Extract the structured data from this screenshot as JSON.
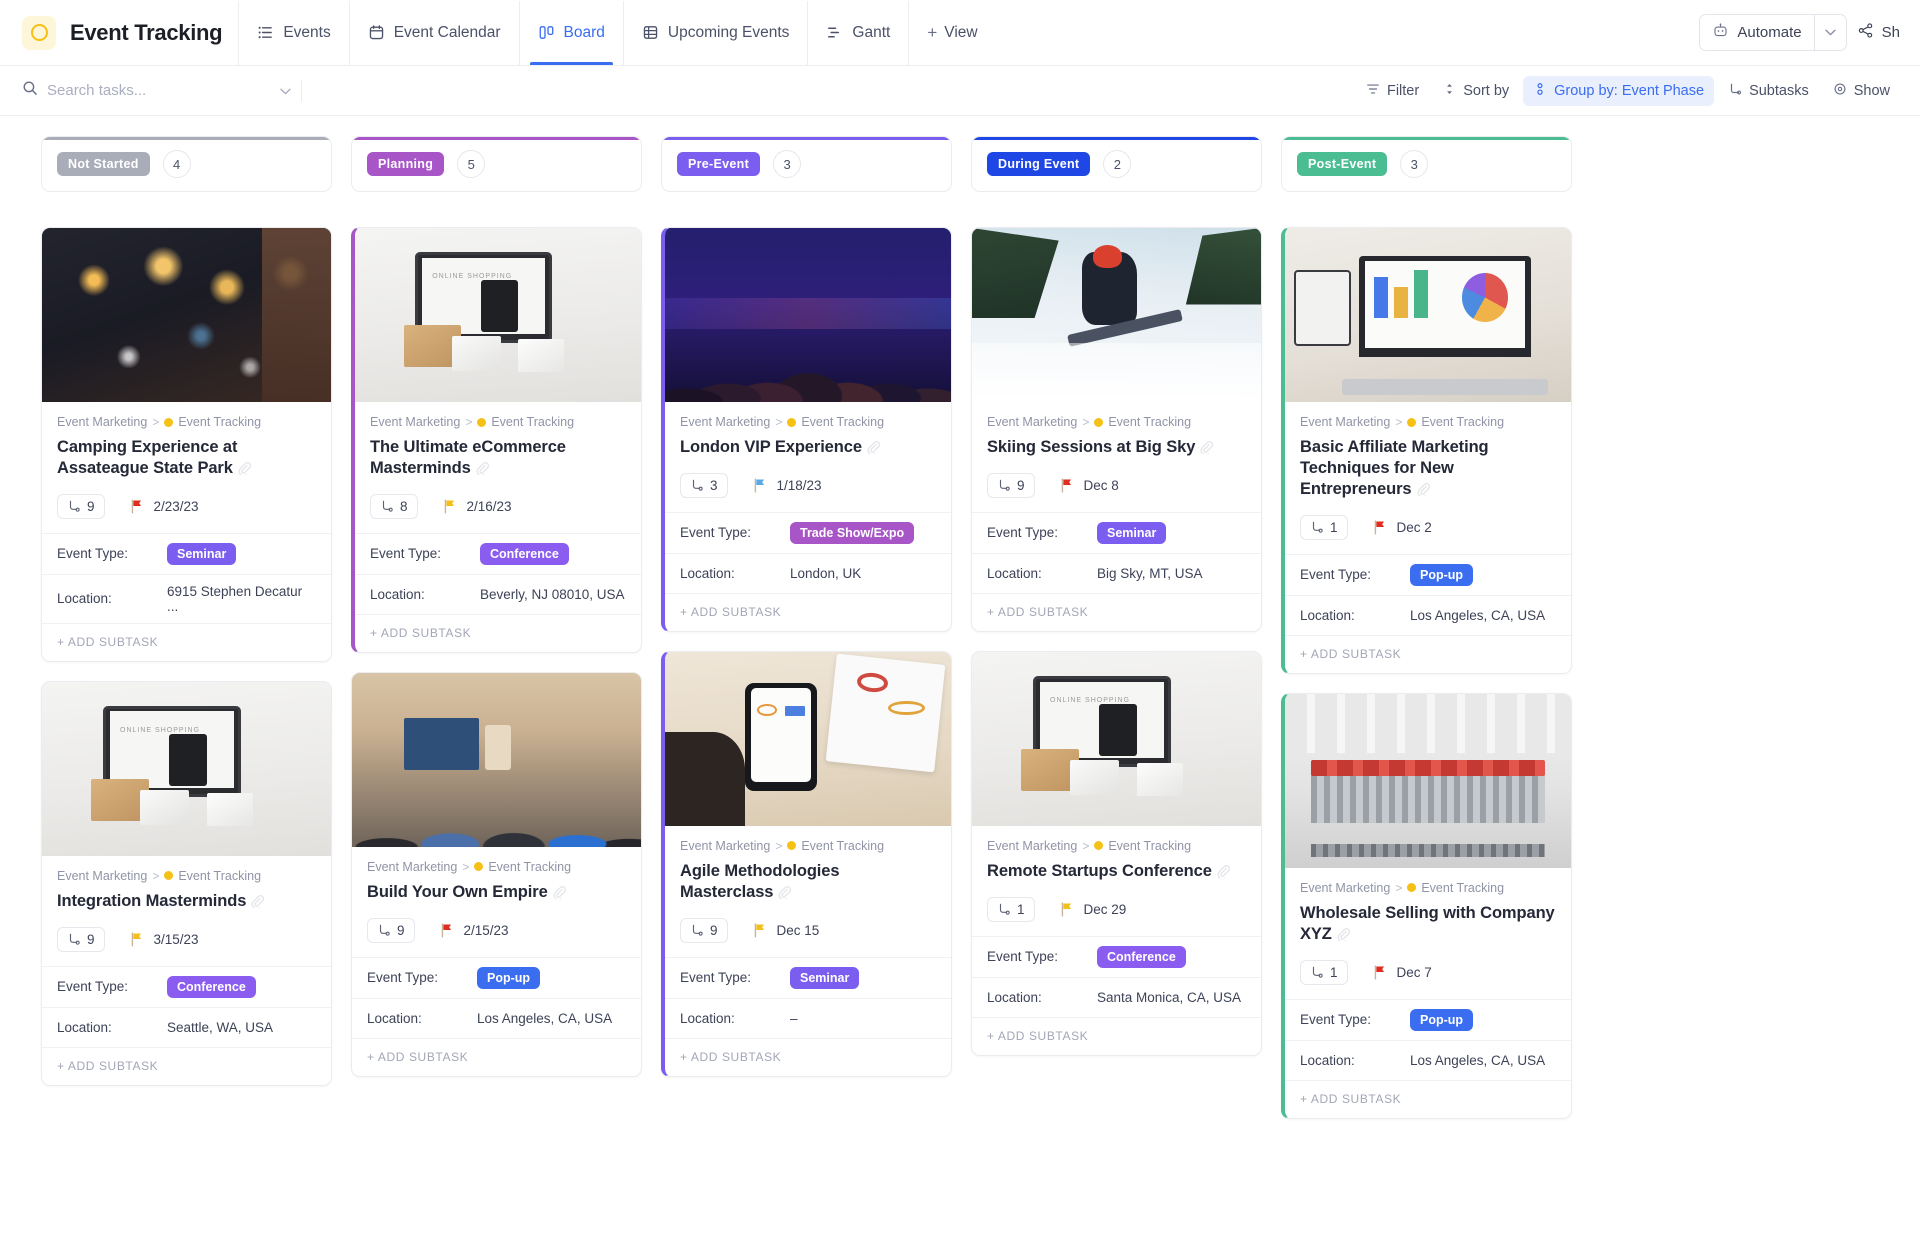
{
  "header": {
    "logo_icon": "ring-logo-icon",
    "title": "Event Tracking",
    "tabs": [
      {
        "label": "Events",
        "icon": "list-icon",
        "active": false
      },
      {
        "label": "Event Calendar",
        "icon": "calendar-icon",
        "active": false
      },
      {
        "label": "Board",
        "icon": "board-icon",
        "active": true
      },
      {
        "label": "Upcoming Events",
        "icon": "table-icon",
        "active": false
      },
      {
        "label": "Gantt",
        "icon": "gantt-icon",
        "active": false
      }
    ],
    "add_view_label": "View",
    "automate_label": "Automate",
    "share_label": "Sh"
  },
  "toolbar": {
    "search_placeholder": "Search tasks...",
    "search_value": "",
    "filter_label": "Filter",
    "sort_label": "Sort by",
    "group_label": "Group by: Event Phase",
    "subtasks_label": "Subtasks",
    "show_label": "Show"
  },
  "columns": [
    {
      "name": "Not Started",
      "count": "4",
      "accent": "#a9adb8",
      "accent_border": "#d8dadf",
      "cards": [
        {
          "breadcrumb_root": "Event Marketing",
          "breadcrumb_leaf": "Event Tracking",
          "title": "Camping Experience at Assateague State Park",
          "subtasks": "9",
          "flag_color": "#e02d1f",
          "date": "2/23/23",
          "type_label": "Event Type:",
          "type_value": "Seminar",
          "type_color": "#7b5ef0",
          "location_label": "Location:",
          "location_value": "6915 Stephen Decatur ...",
          "add_subtask": "+ ADD SUBTASK",
          "image": "holiday-lights-photo",
          "accented": false
        },
        {
          "breadcrumb_root": "Event Marketing",
          "breadcrumb_leaf": "Event Tracking",
          "title": "Integration Masterminds",
          "subtasks": "9",
          "flag_color": "#f3c01b",
          "date": "3/15/23",
          "type_label": "Event Type:",
          "type_value": "Conference",
          "type_color": "#8b5cf0",
          "location_label": "Location:",
          "location_value": "Seattle, WA, USA",
          "add_subtask": "+ ADD SUBTASK",
          "image": "ecommerce-laptop-photo",
          "accented": false
        }
      ]
    },
    {
      "name": "Planning",
      "count": "5",
      "accent": "#a855c7",
      "accent_border": "#a855c7",
      "cards": [
        {
          "breadcrumb_root": "Event Marketing",
          "breadcrumb_leaf": "Event Tracking",
          "title": "The Ultimate eCommerce Masterminds",
          "subtasks": "8",
          "flag_color": "#f3c01b",
          "date": "2/16/23",
          "type_label": "Event Type:",
          "type_value": "Conference",
          "type_color": "#8b5cf0",
          "location_label": "Location:",
          "location_value": "Beverly, NJ 08010, USA",
          "add_subtask": "+ ADD SUBTASK",
          "image": "ecommerce-laptop-photo",
          "accented": true
        },
        {
          "breadcrumb_root": "Event Marketing",
          "breadcrumb_leaf": "Event Tracking",
          "title": "Build Your Own Empire",
          "subtasks": "9",
          "flag_color": "#e02d1f",
          "date": "2/15/23",
          "type_label": "Event Type:",
          "type_value": "Pop-up",
          "type_color": "#3a6df0",
          "location_label": "Location:",
          "location_value": "Los Angeles, CA, USA",
          "add_subtask": "+ ADD SUBTASK",
          "image": "conference-room-photo",
          "accented": false
        }
      ]
    },
    {
      "name": "Pre-Event",
      "count": "3",
      "accent": "#7b5ef0",
      "accent_border": "#7b5ef0",
      "cards": [
        {
          "breadcrumb_root": "Event Marketing",
          "breadcrumb_leaf": "Event Tracking",
          "title": "London VIP Experience",
          "subtasks": "3",
          "flag_color": "#5aa9e6",
          "date": "1/18/23",
          "type_label": "Event Type:",
          "type_value": "Trade Show/Expo",
          "type_color": "#a855c7",
          "location_label": "Location:",
          "location_value": "London, UK",
          "add_subtask": "+ ADD SUBTASK",
          "image": "audience-crowd-photo",
          "accented": true
        },
        {
          "breadcrumb_root": "Event Marketing",
          "breadcrumb_leaf": "Event Tracking",
          "title": "Agile Methodologies Masterclass",
          "subtasks": "9",
          "flag_color": "#f3c01b",
          "date": "Dec 15",
          "type_label": "Event Type:",
          "type_value": "Seminar",
          "type_color": "#7b5ef0",
          "location_label": "Location:",
          "location_value": "–",
          "add_subtask": "+ ADD SUBTASK",
          "image": "analytics-phone-photo",
          "accented": true
        }
      ]
    },
    {
      "name": "During Event",
      "count": "2",
      "accent": "#1f47e6",
      "accent_border": "#1f47e6",
      "cards": [
        {
          "breadcrumb_root": "Event Marketing",
          "breadcrumb_leaf": "Event Tracking",
          "title": "Skiing Sessions at Big Sky",
          "subtasks": "9",
          "flag_color": "#e02d1f",
          "date": "Dec 8",
          "type_label": "Event Type:",
          "type_value": "Seminar",
          "type_color": "#7b5ef0",
          "location_label": "Location:",
          "location_value": "Big Sky, MT, USA",
          "add_subtask": "+ ADD SUBTASK",
          "image": "skier-snow-photo",
          "accented": false
        },
        {
          "breadcrumb_root": "Event Marketing",
          "breadcrumb_leaf": "Event Tracking",
          "title": "Remote Startups Conference",
          "subtasks": "1",
          "flag_color": "#f3c01b",
          "date": "Dec 29",
          "type_label": "Event Type:",
          "type_value": "Conference",
          "type_color": "#8b5cf0",
          "location_label": "Location:",
          "location_value": "Santa Monica, CA, USA",
          "add_subtask": "+ ADD SUBTASK",
          "image": "ecommerce-laptop-photo",
          "accented": false
        }
      ]
    },
    {
      "name": "Post-Event",
      "count": "3",
      "accent": "#4bbd93",
      "accent_border": "#4bbd93",
      "cards": [
        {
          "breadcrumb_root": "Event Marketing",
          "breadcrumb_leaf": "Event Tracking",
          "title": "Basic Affiliate Marketing Techniques for New Entrepreneurs",
          "subtasks": "1",
          "flag_color": "#e02d1f",
          "date": "Dec 2",
          "type_label": "Event Type:",
          "type_value": "Pop-up",
          "type_color": "#3a6df0",
          "location_label": "Location:",
          "location_value": "Los Angeles, CA, USA",
          "add_subtask": "+ ADD SUBTASK",
          "image": "dashboard-laptop-photo",
          "accented": true
        },
        {
          "breadcrumb_root": "Event Marketing",
          "breadcrumb_leaf": "Event Tracking",
          "title": "Wholesale Selling with Company XYZ",
          "subtasks": "1",
          "flag_color": "#e02d1f",
          "date": "Dec 7",
          "type_label": "Event Type:",
          "type_value": "Pop-up",
          "type_color": "#3a6df0",
          "location_label": "Location:",
          "location_value": "Los Angeles, CA, USA",
          "add_subtask": "+ ADD SUBTASK",
          "image": "shopping-carts-photo",
          "accented": true
        }
      ]
    }
  ]
}
